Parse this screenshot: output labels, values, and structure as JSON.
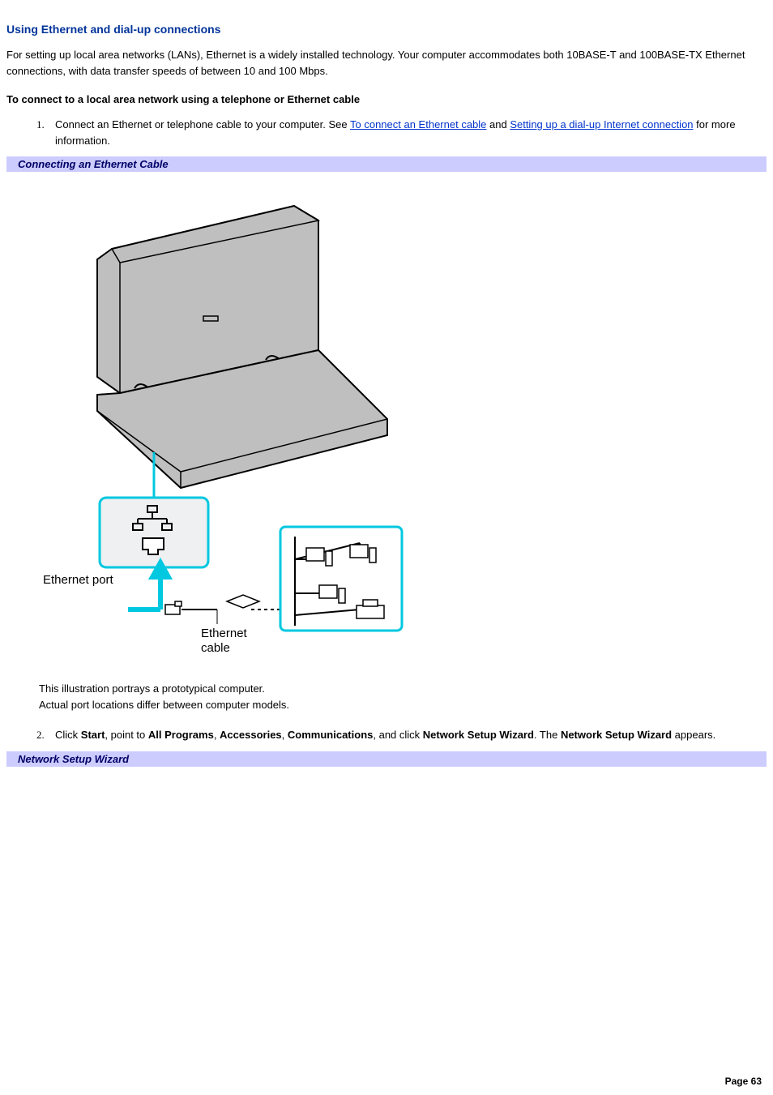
{
  "heading": "Using Ethernet and dial-up connections",
  "intro": "For setting up local area networks (LANs), Ethernet is a widely installed technology. Your computer accommodates both 10BASE-T and 100BASE-TX Ethernet connections, with data transfer speeds of between 10 and 100 Mbps.",
  "subheading": "To connect to a local area network using a telephone or Ethernet cable",
  "step1_pre": "Connect an Ethernet or telephone cable to your computer. See ",
  "step1_link1": "To connect an Ethernet cable",
  "step1_mid": " and ",
  "step1_link2": "Setting up a dial-up Internet connection",
  "step1_post": " for more information.",
  "figure1_caption": "Connecting an Ethernet Cable",
  "figure1_label_port": "Ethernet port",
  "figure1_label_cable_l1": "Ethernet",
  "figure1_label_cable_l2": "cable",
  "figure1_note_l1": "This illustration portrays a prototypical computer.",
  "figure1_note_l2": "Actual port locations differ between computer models.",
  "step2_t1": "Click ",
  "step2_b1": "Start",
  "step2_t2": ", point to ",
  "step2_b2": "All Programs",
  "step2_t3": ", ",
  "step2_b3": "Accessories",
  "step2_t4": ", ",
  "step2_b4": "Communications",
  "step2_t5": ", and click ",
  "step2_b5": "Network Setup Wizard",
  "step2_t6": ". The ",
  "step2_b6": "Network Setup Wizard",
  "step2_t7": " appears.",
  "figure2_caption": "Network Setup Wizard",
  "page_footer": "Page 63"
}
